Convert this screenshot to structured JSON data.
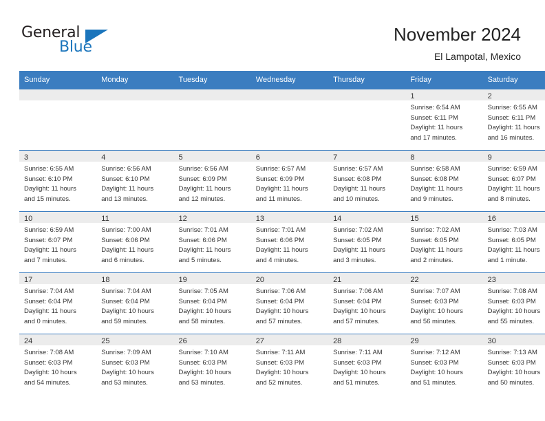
{
  "brand": {
    "name_part1": "General",
    "name_part2": "Blue"
  },
  "header": {
    "title": "November 2024",
    "subtitle": "El Lampotal, Mexico"
  },
  "calendar": {
    "weekday_headers": [
      "Sunday",
      "Monday",
      "Tuesday",
      "Wednesday",
      "Thursday",
      "Friday",
      "Saturday"
    ],
    "colors": {
      "header_bg": "#3b7dc0",
      "daynum_bg": "#ececec",
      "row_rule": "#3b7dc0",
      "text": "#333333",
      "brand_blue": "#1b75bc"
    },
    "weeks": [
      [
        {
          "day": "",
          "empty": true
        },
        {
          "day": "",
          "empty": true
        },
        {
          "day": "",
          "empty": true
        },
        {
          "day": "",
          "empty": true
        },
        {
          "day": "",
          "empty": true
        },
        {
          "day": "1",
          "sunrise": "Sunrise: 6:54 AM",
          "sunset": "Sunset: 6:11 PM",
          "daylight1": "Daylight: 11 hours",
          "daylight2": "and 17 minutes."
        },
        {
          "day": "2",
          "sunrise": "Sunrise: 6:55 AM",
          "sunset": "Sunset: 6:11 PM",
          "daylight1": "Daylight: 11 hours",
          "daylight2": "and 16 minutes."
        }
      ],
      [
        {
          "day": "3",
          "sunrise": "Sunrise: 6:55 AM",
          "sunset": "Sunset: 6:10 PM",
          "daylight1": "Daylight: 11 hours",
          "daylight2": "and 15 minutes."
        },
        {
          "day": "4",
          "sunrise": "Sunrise: 6:56 AM",
          "sunset": "Sunset: 6:10 PM",
          "daylight1": "Daylight: 11 hours",
          "daylight2": "and 13 minutes."
        },
        {
          "day": "5",
          "sunrise": "Sunrise: 6:56 AM",
          "sunset": "Sunset: 6:09 PM",
          "daylight1": "Daylight: 11 hours",
          "daylight2": "and 12 minutes."
        },
        {
          "day": "6",
          "sunrise": "Sunrise: 6:57 AM",
          "sunset": "Sunset: 6:09 PM",
          "daylight1": "Daylight: 11 hours",
          "daylight2": "and 11 minutes."
        },
        {
          "day": "7",
          "sunrise": "Sunrise: 6:57 AM",
          "sunset": "Sunset: 6:08 PM",
          "daylight1": "Daylight: 11 hours",
          "daylight2": "and 10 minutes."
        },
        {
          "day": "8",
          "sunrise": "Sunrise: 6:58 AM",
          "sunset": "Sunset: 6:08 PM",
          "daylight1": "Daylight: 11 hours",
          "daylight2": "and 9 minutes."
        },
        {
          "day": "9",
          "sunrise": "Sunrise: 6:59 AM",
          "sunset": "Sunset: 6:07 PM",
          "daylight1": "Daylight: 11 hours",
          "daylight2": "and 8 minutes."
        }
      ],
      [
        {
          "day": "10",
          "sunrise": "Sunrise: 6:59 AM",
          "sunset": "Sunset: 6:07 PM",
          "daylight1": "Daylight: 11 hours",
          "daylight2": "and 7 minutes."
        },
        {
          "day": "11",
          "sunrise": "Sunrise: 7:00 AM",
          "sunset": "Sunset: 6:06 PM",
          "daylight1": "Daylight: 11 hours",
          "daylight2": "and 6 minutes."
        },
        {
          "day": "12",
          "sunrise": "Sunrise: 7:01 AM",
          "sunset": "Sunset: 6:06 PM",
          "daylight1": "Daylight: 11 hours",
          "daylight2": "and 5 minutes."
        },
        {
          "day": "13",
          "sunrise": "Sunrise: 7:01 AM",
          "sunset": "Sunset: 6:06 PM",
          "daylight1": "Daylight: 11 hours",
          "daylight2": "and 4 minutes."
        },
        {
          "day": "14",
          "sunrise": "Sunrise: 7:02 AM",
          "sunset": "Sunset: 6:05 PM",
          "daylight1": "Daylight: 11 hours",
          "daylight2": "and 3 minutes."
        },
        {
          "day": "15",
          "sunrise": "Sunrise: 7:02 AM",
          "sunset": "Sunset: 6:05 PM",
          "daylight1": "Daylight: 11 hours",
          "daylight2": "and 2 minutes."
        },
        {
          "day": "16",
          "sunrise": "Sunrise: 7:03 AM",
          "sunset": "Sunset: 6:05 PM",
          "daylight1": "Daylight: 11 hours",
          "daylight2": "and 1 minute."
        }
      ],
      [
        {
          "day": "17",
          "sunrise": "Sunrise: 7:04 AM",
          "sunset": "Sunset: 6:04 PM",
          "daylight1": "Daylight: 11 hours",
          "daylight2": "and 0 minutes."
        },
        {
          "day": "18",
          "sunrise": "Sunrise: 7:04 AM",
          "sunset": "Sunset: 6:04 PM",
          "daylight1": "Daylight: 10 hours",
          "daylight2": "and 59 minutes."
        },
        {
          "day": "19",
          "sunrise": "Sunrise: 7:05 AM",
          "sunset": "Sunset: 6:04 PM",
          "daylight1": "Daylight: 10 hours",
          "daylight2": "and 58 minutes."
        },
        {
          "day": "20",
          "sunrise": "Sunrise: 7:06 AM",
          "sunset": "Sunset: 6:04 PM",
          "daylight1": "Daylight: 10 hours",
          "daylight2": "and 57 minutes."
        },
        {
          "day": "21",
          "sunrise": "Sunrise: 7:06 AM",
          "sunset": "Sunset: 6:04 PM",
          "daylight1": "Daylight: 10 hours",
          "daylight2": "and 57 minutes."
        },
        {
          "day": "22",
          "sunrise": "Sunrise: 7:07 AM",
          "sunset": "Sunset: 6:03 PM",
          "daylight1": "Daylight: 10 hours",
          "daylight2": "and 56 minutes."
        },
        {
          "day": "23",
          "sunrise": "Sunrise: 7:08 AM",
          "sunset": "Sunset: 6:03 PM",
          "daylight1": "Daylight: 10 hours",
          "daylight2": "and 55 minutes."
        }
      ],
      [
        {
          "day": "24",
          "sunrise": "Sunrise: 7:08 AM",
          "sunset": "Sunset: 6:03 PM",
          "daylight1": "Daylight: 10 hours",
          "daylight2": "and 54 minutes."
        },
        {
          "day": "25",
          "sunrise": "Sunrise: 7:09 AM",
          "sunset": "Sunset: 6:03 PM",
          "daylight1": "Daylight: 10 hours",
          "daylight2": "and 53 minutes."
        },
        {
          "day": "26",
          "sunrise": "Sunrise: 7:10 AM",
          "sunset": "Sunset: 6:03 PM",
          "daylight1": "Daylight: 10 hours",
          "daylight2": "and 53 minutes."
        },
        {
          "day": "27",
          "sunrise": "Sunrise: 7:11 AM",
          "sunset": "Sunset: 6:03 PM",
          "daylight1": "Daylight: 10 hours",
          "daylight2": "and 52 minutes."
        },
        {
          "day": "28",
          "sunrise": "Sunrise: 7:11 AM",
          "sunset": "Sunset: 6:03 PM",
          "daylight1": "Daylight: 10 hours",
          "daylight2": "and 51 minutes."
        },
        {
          "day": "29",
          "sunrise": "Sunrise: 7:12 AM",
          "sunset": "Sunset: 6:03 PM",
          "daylight1": "Daylight: 10 hours",
          "daylight2": "and 51 minutes."
        },
        {
          "day": "30",
          "sunrise": "Sunrise: 7:13 AM",
          "sunset": "Sunset: 6:03 PM",
          "daylight1": "Daylight: 10 hours",
          "daylight2": "and 50 minutes."
        }
      ]
    ]
  }
}
